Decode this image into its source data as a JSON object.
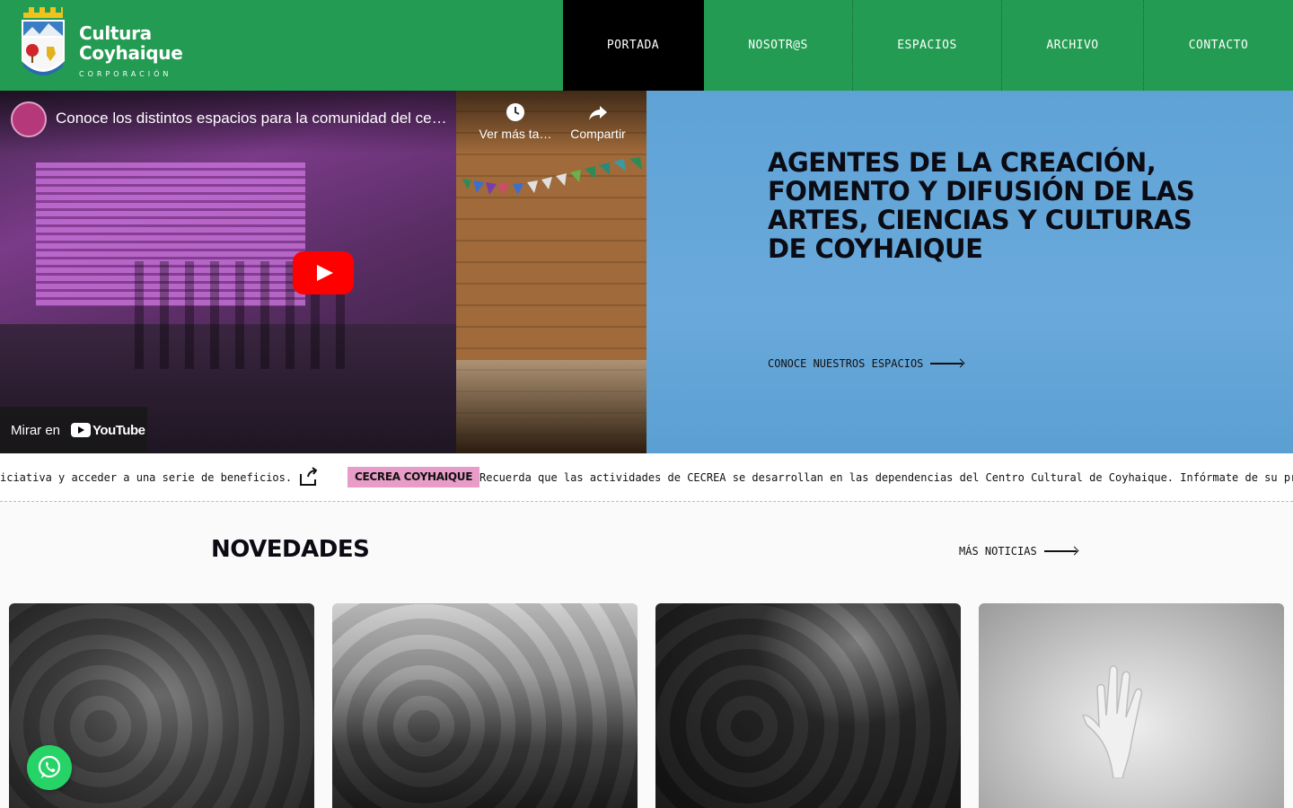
{
  "brand": {
    "line1": "Cultura",
    "line2": "Coyhaique",
    "sub": "CORPORACIÓN"
  },
  "nav": {
    "items": [
      {
        "label": "PORTADA",
        "active": true
      },
      {
        "label": "NOSOTR@S"
      },
      {
        "label": "ESPACIOS"
      },
      {
        "label": "ARCHIVO"
      },
      {
        "label": "CONTACTO"
      }
    ]
  },
  "video": {
    "title": "Conoce los distintos espacios para la comunidad del ce…",
    "watch_later": "Ver más ta…",
    "share": "Compartir",
    "watch_on": "Mirar en",
    "youtube": "YouTube"
  },
  "hero": {
    "heading": "AGENTES DE LA CREACIÓN, FOMENTO Y DIFUSIÓN DE LAS ARTES, CIENCIAS Y CULTURAS DE COYHAIQUE",
    "link": "CONOCE NUESTROS ESPACIOS"
  },
  "ticker": {
    "text_before": "iciativa y acceder a una serie de beneficios.",
    "badge": "CECREA COYHAIQUE",
    "text_after": "Recuerda que las actividades de CECREA se desarrollan en las dependencias del Centro Cultural de Coyhaique. Infórmate de su pr"
  },
  "news": {
    "title": "NOVEDADES",
    "more": "MÁS NOTICIAS"
  },
  "colors": {
    "header_green": "#239b52",
    "hero_blue": "#5fa3d6",
    "badge_pink": "#e89cc8",
    "youtube_red": "#ff0000",
    "whatsapp_green": "#25d366"
  },
  "icons": [
    "clock-icon",
    "share-icon",
    "youtube-play-icon",
    "share-box-icon",
    "arrow-right-icon",
    "whatsapp-icon",
    "crest-logo"
  ]
}
